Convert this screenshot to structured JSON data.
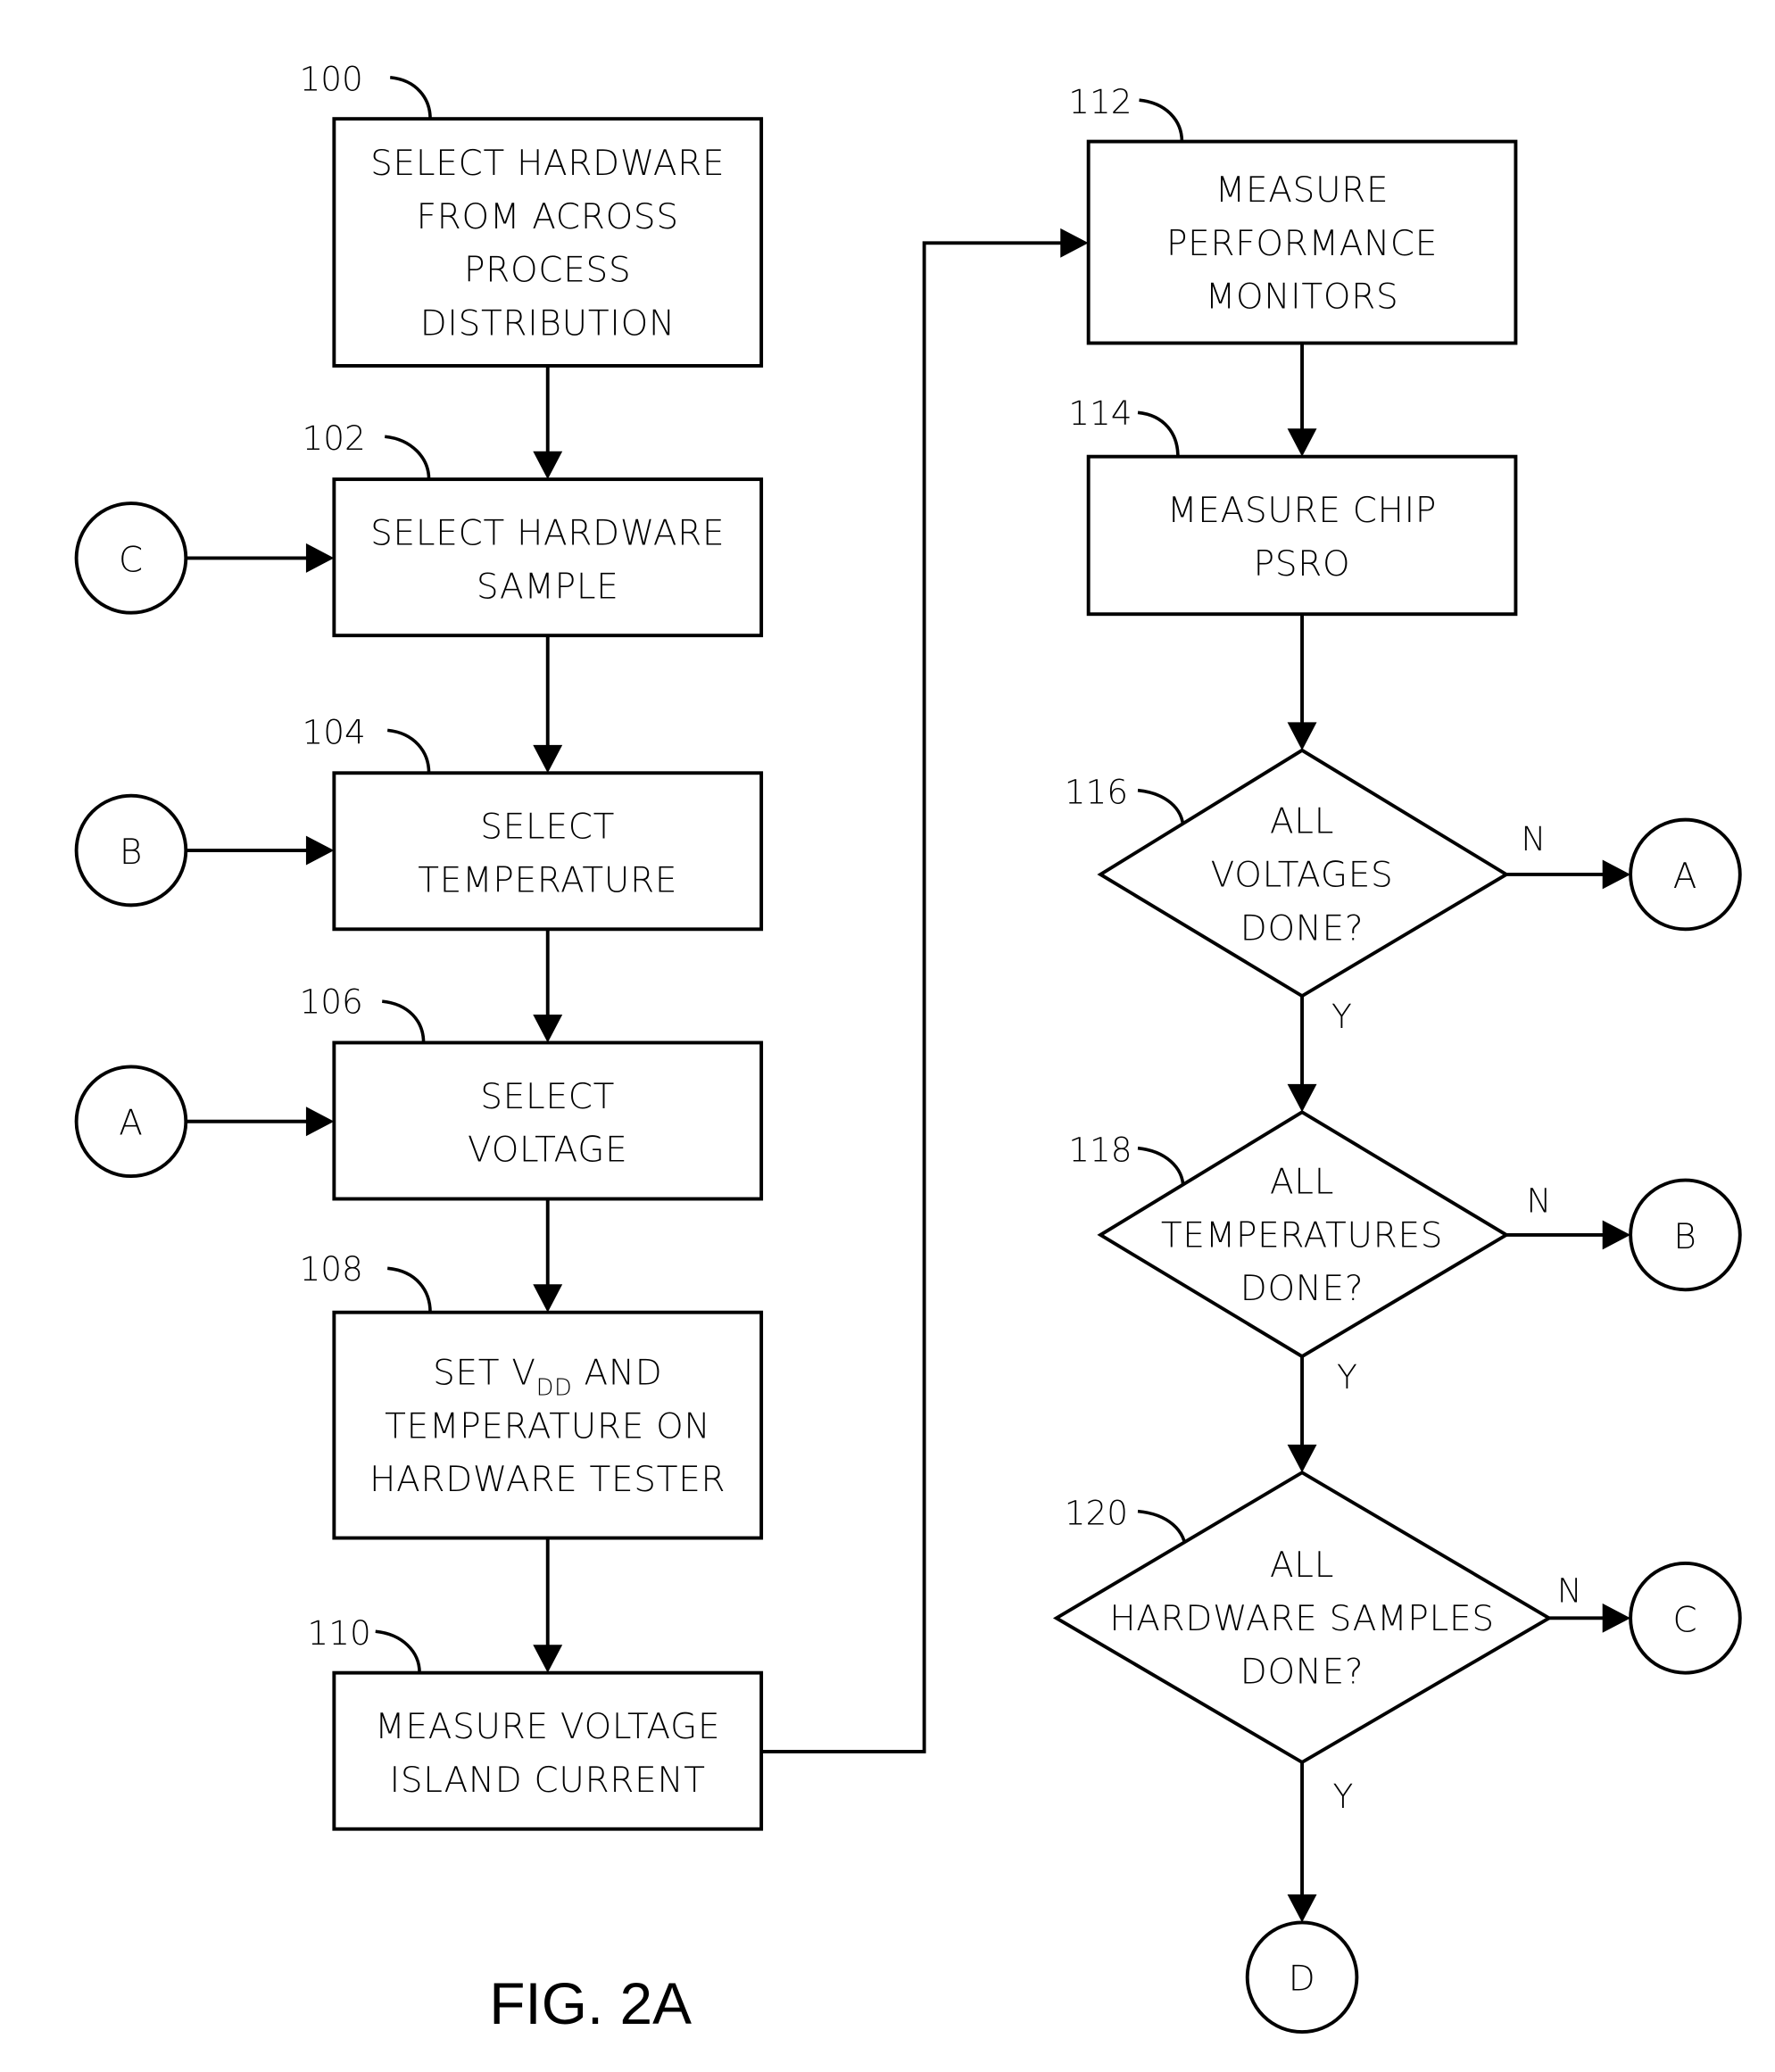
{
  "figure_label": "FIG. 2A",
  "steps": {
    "s100": {
      "ref": "100",
      "lines": [
        "SELECT HARDWARE",
        "FROM ACROSS",
        "PROCESS",
        "DISTRIBUTION"
      ]
    },
    "s102": {
      "ref": "102",
      "lines": [
        "SELECT HARDWARE",
        "SAMPLE"
      ]
    },
    "s104": {
      "ref": "104",
      "lines": [
        "SELECT",
        "TEMPERATURE"
      ]
    },
    "s106": {
      "ref": "106",
      "lines": [
        "SELECT",
        "VOLTAGE"
      ]
    },
    "s108": {
      "ref": "108",
      "line1_pre": "SET V",
      "line1_sub": "DD",
      "line1_post": " AND",
      "lines": [
        "TEMPERATURE ON",
        "HARDWARE TESTER"
      ]
    },
    "s110": {
      "ref": "110",
      "lines": [
        "MEASURE VOLTAGE",
        "ISLAND CURRENT"
      ]
    },
    "s112": {
      "ref": "112",
      "lines": [
        "MEASURE",
        "PERFORMANCE",
        "MONITORS"
      ]
    },
    "s114": {
      "ref": "114",
      "lines": [
        "MEASURE CHIP",
        "PSRO"
      ]
    }
  },
  "decisions": {
    "d116": {
      "ref": "116",
      "lines": [
        "ALL",
        "VOLTAGES",
        "DONE?"
      ],
      "no": "N",
      "yes": "Y"
    },
    "d118": {
      "ref": "118",
      "lines": [
        "ALL",
        "TEMPERATURES",
        "DONE?"
      ],
      "no": "N",
      "yes": "Y"
    },
    "d120": {
      "ref": "120",
      "lines": [
        "ALL",
        "HARDWARE SAMPLES",
        "DONE?"
      ],
      "no": "N",
      "yes": "Y"
    }
  },
  "connectors": {
    "in_c": "C",
    "in_b": "B",
    "in_a": "A",
    "out_a": "A",
    "out_b": "B",
    "out_c": "C",
    "out_d": "D"
  }
}
